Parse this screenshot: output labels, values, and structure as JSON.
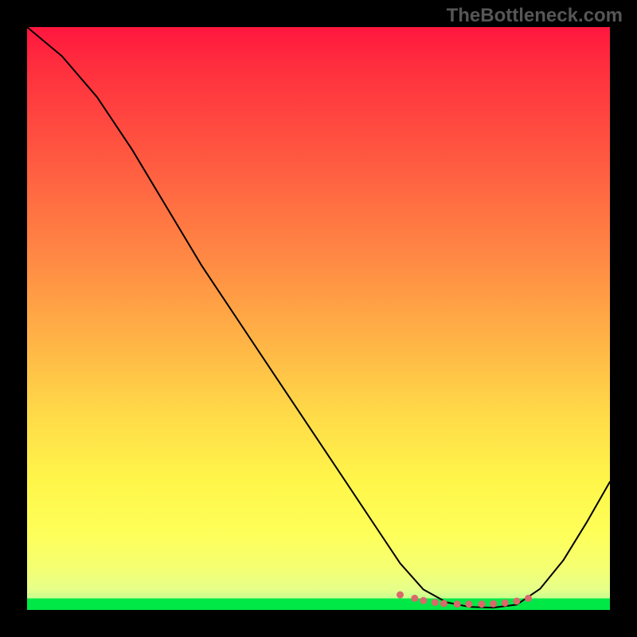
{
  "watermark": "TheBottleneck.com",
  "chart_data": {
    "type": "line",
    "title": "",
    "xlabel": "",
    "ylabel": "",
    "xlim": [
      0,
      100
    ],
    "ylim": [
      0,
      100
    ],
    "grid": false,
    "legend": false,
    "series": [
      {
        "name": "curve",
        "x": [
          0,
          6,
          12,
          18,
          24,
          30,
          36,
          42,
          48,
          54,
          60,
          64,
          68,
          72,
          76,
          80,
          84,
          88,
          92,
          96,
          100
        ],
        "values": [
          100,
          95,
          88,
          79,
          69,
          59,
          50,
          41,
          32,
          23,
          14,
          8,
          3.5,
          1.3,
          0.5,
          0.4,
          0.9,
          3.6,
          8.5,
          15,
          22
        ],
        "color": "#000000",
        "width": 2
      },
      {
        "name": "dotted-baseline",
        "type": "scatter",
        "x": [
          64,
          66.5,
          68,
          70,
          71.5,
          73.8,
          75.8,
          78,
          80,
          82,
          84,
          86
        ],
        "values": [
          2.6,
          2.0,
          1.6,
          1.3,
          1.1,
          1.0,
          1.0,
          1.0,
          1.05,
          1.2,
          1.5,
          2.0
        ],
        "color": "#d86a6a",
        "size": 4.5
      }
    ],
    "background_gradient": {
      "stops": [
        {
          "pos": 0,
          "color": "#ff163e"
        },
        {
          "pos": 40,
          "color": "#ff8a44"
        },
        {
          "pos": 78,
          "color": "#fff64a"
        },
        {
          "pos": 97,
          "color": "#e6ff8a"
        },
        {
          "pos": 98,
          "color": "#00e846"
        },
        {
          "pos": 100,
          "color": "#00e846"
        }
      ]
    }
  }
}
